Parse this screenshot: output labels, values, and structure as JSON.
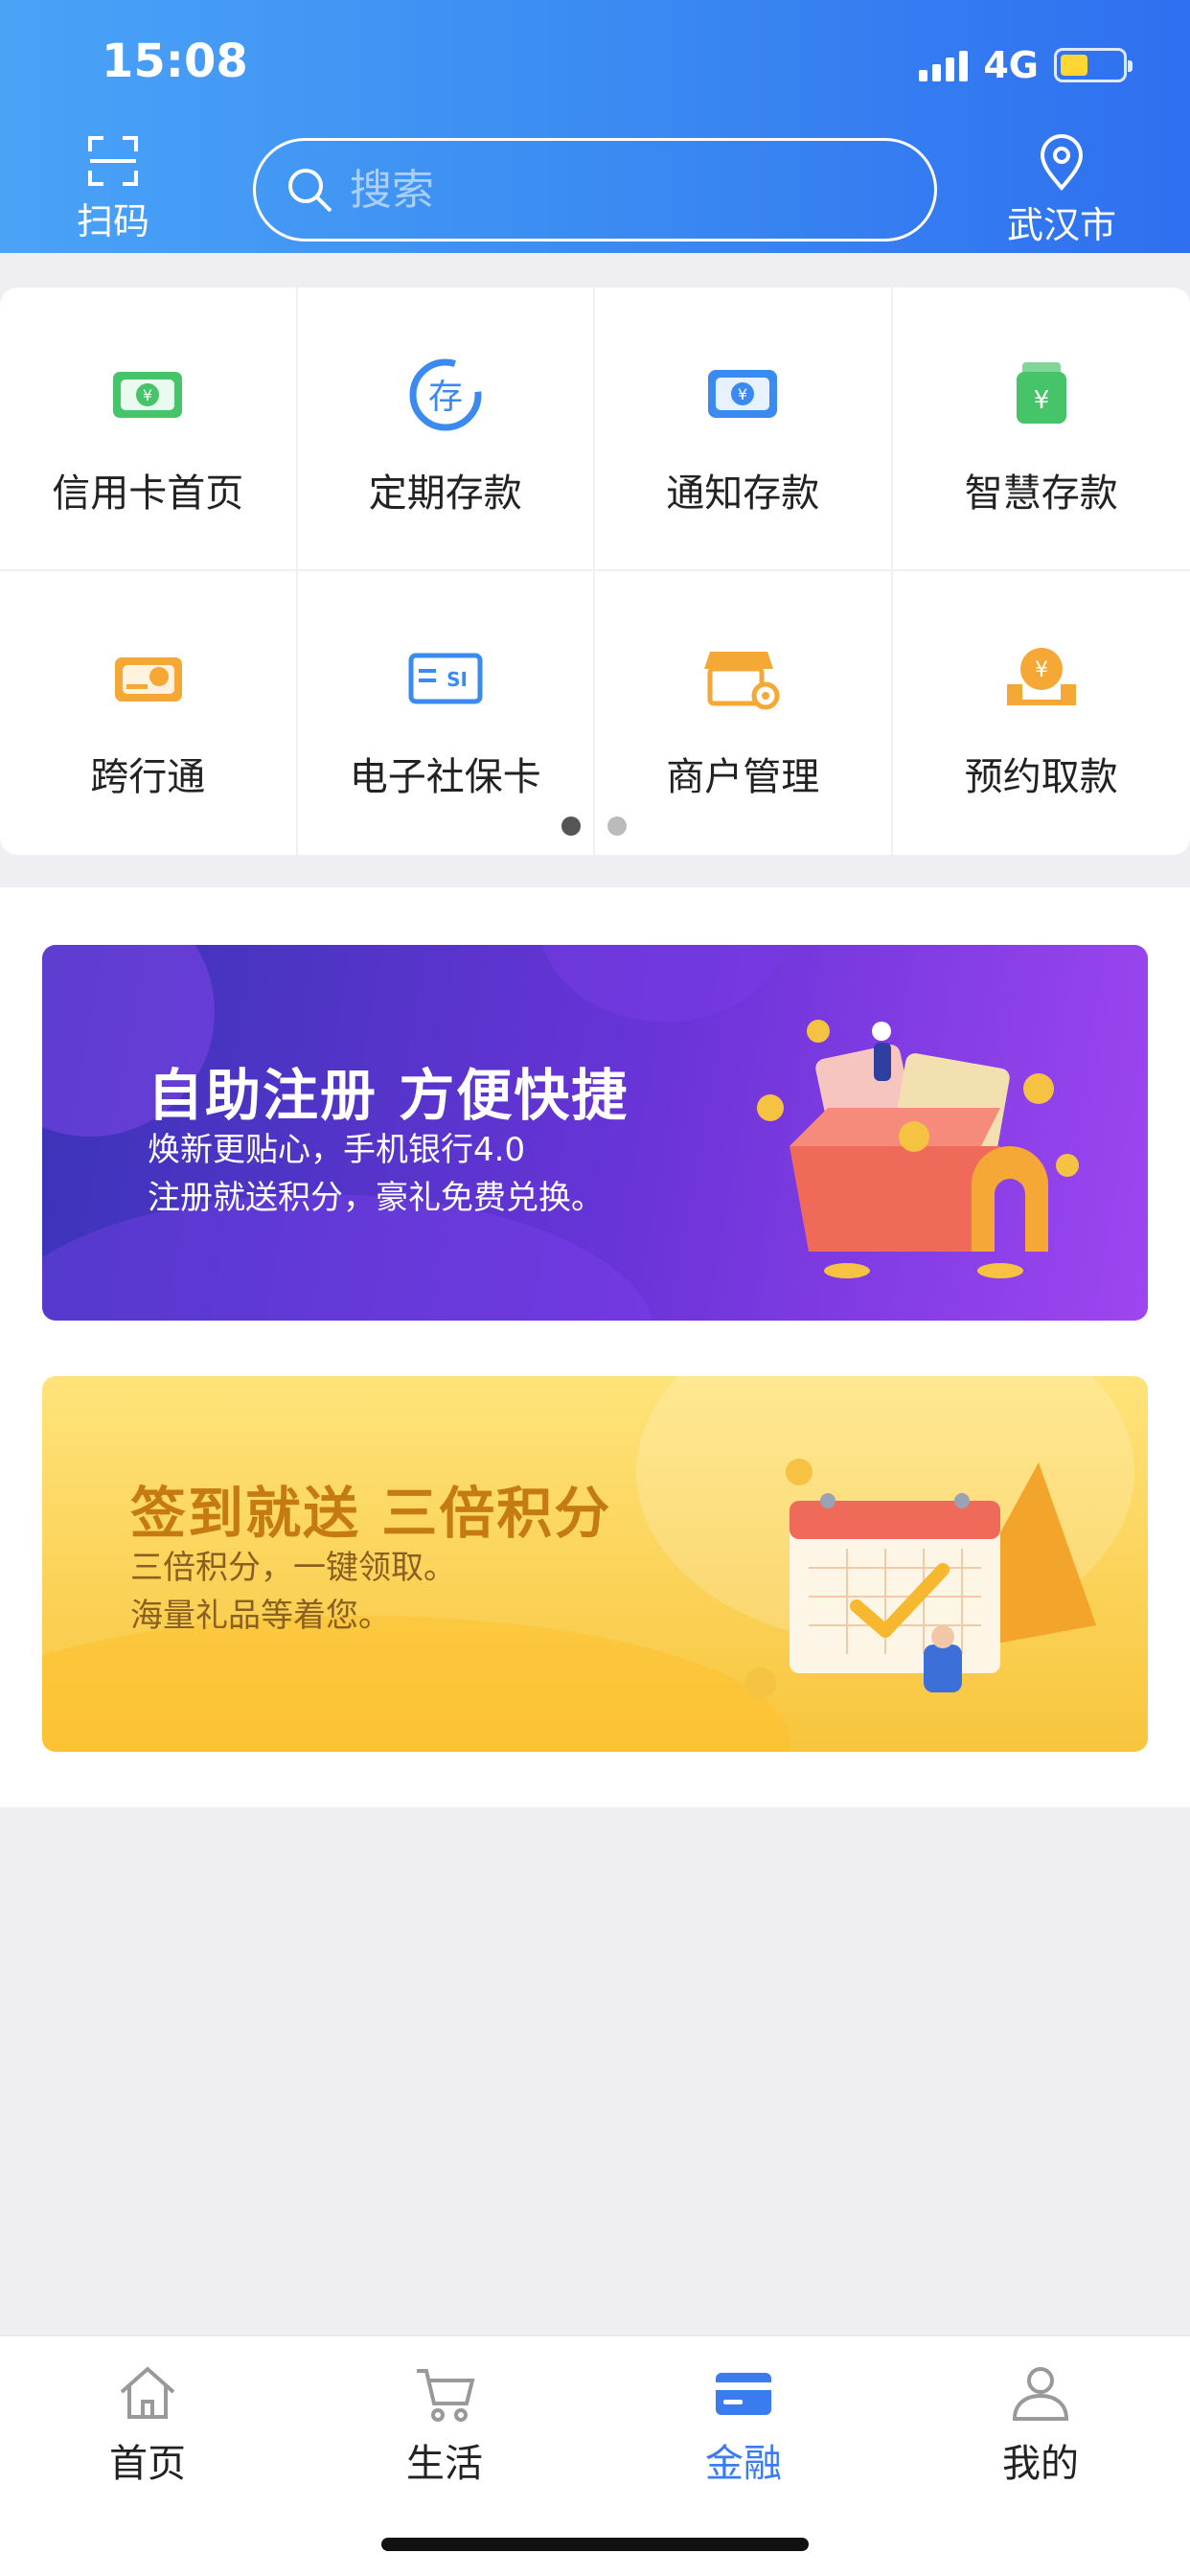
{
  "status": {
    "time": "15:08",
    "network": "4G"
  },
  "header": {
    "scan_label": "扫码",
    "search_placeholder": "搜索",
    "location_label": "武汉市"
  },
  "grid": {
    "items": [
      {
        "label": "信用卡首页",
        "icon": "credit-card-icon"
      },
      {
        "label": "定期存款",
        "icon": "deposit-icon"
      },
      {
        "label": "通知存款",
        "icon": "notice-deposit-icon"
      },
      {
        "label": "智慧存款",
        "icon": "smart-deposit-icon"
      },
      {
        "label": "跨行通",
        "icon": "interbank-icon"
      },
      {
        "label": "电子社保卡",
        "icon": "social-security-card-icon"
      },
      {
        "label": "商户管理",
        "icon": "merchant-manage-icon"
      },
      {
        "label": "预约取款",
        "icon": "reserve-withdraw-icon"
      }
    ],
    "page_index": 1,
    "page_count": 2
  },
  "banners": [
    {
      "title": "自助注册  方便快捷",
      "lines": [
        "焕新更贴心，手机银行4.0",
        "注册就送积分，豪礼免费兑换。"
      ]
    },
    {
      "title": "签到就送  三倍积分",
      "lines": [
        "三倍积分，一键领取。",
        "海量礼品等着您。"
      ]
    }
  ],
  "tabbar": {
    "items": [
      {
        "label": "首页",
        "icon": "home-icon"
      },
      {
        "label": "生活",
        "icon": "cart-icon"
      },
      {
        "label": "金融",
        "icon": "card-icon"
      },
      {
        "label": "我的",
        "icon": "person-icon"
      }
    ],
    "active": "金融"
  },
  "colors": {
    "accent": "#3a7cf0",
    "header_start": "#4aa3f7",
    "header_end": "#2f6ff0"
  }
}
